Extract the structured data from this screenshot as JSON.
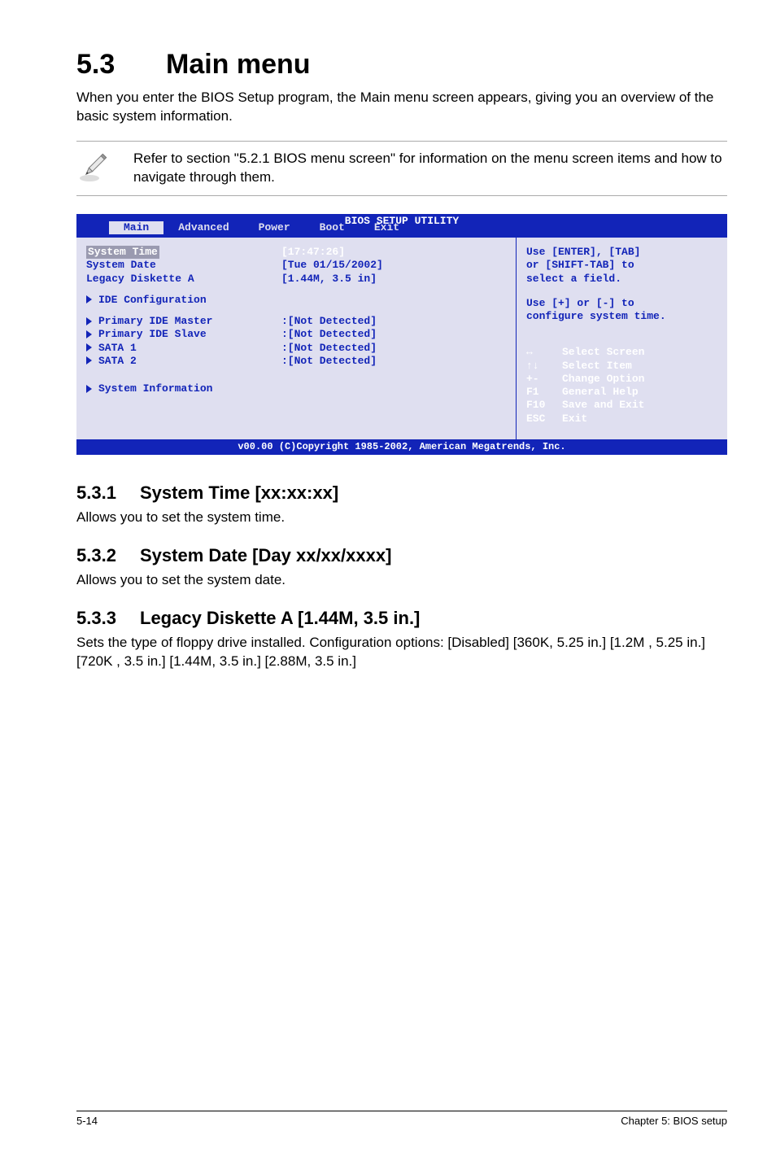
{
  "h1": {
    "num": "5.3",
    "title": "Main menu"
  },
  "intro": "When you enter the BIOS Setup program, the Main menu screen appears, giving you an overview of the basic system information.",
  "note": "Refer to section \"5.2.1  BIOS menu screen\" for information on the menu screen items and how to navigate through them.",
  "bios": {
    "title": "BIOS SETUP UTILITY",
    "tabs": [
      "Main",
      "Advanced",
      "Power",
      "Boot",
      "Exit"
    ],
    "active_tab": "Main",
    "fields": {
      "system_time": {
        "label": "System Time",
        "value": "[17:47:26]"
      },
      "system_date": {
        "label": "System Date",
        "value": "[Tue 01/15/2002]"
      },
      "legacy_diskette": {
        "label": "Legacy Diskette A",
        "value": "[1.44M, 3.5 in]"
      },
      "ide_config": {
        "label": "IDE Configuration"
      },
      "pm": {
        "label": "Primary IDE Master",
        "value": ":[Not Detected]"
      },
      "ps": {
        "label": "Primary IDE Slave",
        "value": ":[Not Detected]"
      },
      "s1": {
        "label": "SATA 1",
        "value": ":[Not Detected]"
      },
      "s2": {
        "label": "SATA 2",
        "value": ":[Not Detected]"
      },
      "sysinfo": {
        "label": "System Information"
      }
    },
    "help": {
      "l1": "Use [ENTER], [TAB]",
      "l2": "or [SHIFT-TAB] to",
      "l3": "select a field.",
      "l4": "Use [+] or [-] to",
      "l5": "configure system time."
    },
    "keys": [
      {
        "k": "↔",
        "d": "Select Screen"
      },
      {
        "k": "↑↓",
        "d": "Select Item"
      },
      {
        "k": "+-",
        "d": "Change Option"
      },
      {
        "k": "F1",
        "d": "General Help"
      },
      {
        "k": "F10",
        "d": "Save and Exit"
      },
      {
        "k": "ESC",
        "d": "Exit"
      }
    ],
    "footer": "v00.00 (C)Copyright 1985-2002, American Megatrends, Inc."
  },
  "sections": {
    "s1": {
      "num": "5.3.1",
      "title": "System Time [xx:xx:xx]",
      "body": "Allows you to set the system time."
    },
    "s2": {
      "num": "5.3.2",
      "title": "System Date [Day xx/xx/xxxx]",
      "body": "Allows you to set the system date."
    },
    "s3": {
      "num": "5.3.3",
      "title": "Legacy Diskette A [1.44M, 3.5 in.]",
      "body": "Sets the type of floppy drive installed. Configuration options: [Disabled] [360K, 5.25 in.] [1.2M , 5.25 in.] [720K , 3.5 in.] [1.44M, 3.5 in.] [2.88M, 3.5 in.]"
    }
  },
  "footer": {
    "left": "5-14",
    "right": "Chapter 5: BIOS setup"
  }
}
